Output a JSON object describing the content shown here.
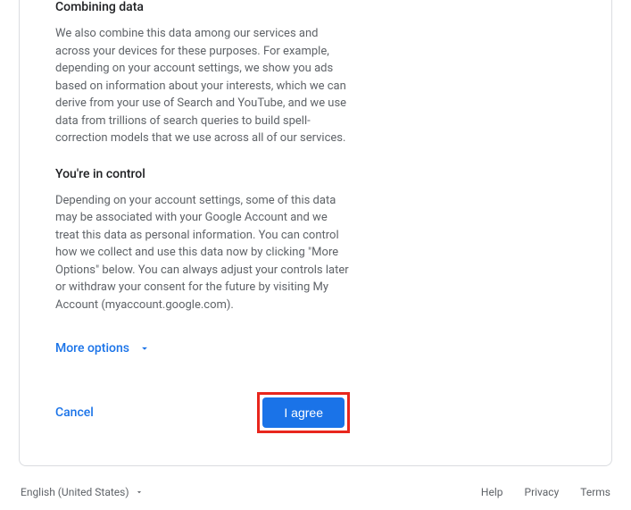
{
  "sections": {
    "combining": {
      "heading": "Combining data",
      "body": "We also combine this data among our services and across your devices for these purposes. For example, depending on your account settings, we show you ads based on information about your interests, which we can derive from your use of Search and YouTube, and we use data from trillions of search queries to build spell-correction models that we use across all of our services."
    },
    "control": {
      "heading": "You're in control",
      "body": "Depending on your account settings, some of this data may be associated with your Google Account and we treat this data as personal information. You can control how we collect and use this data now by clicking \"More Options\" below. You can always adjust your controls later or withdraw your consent for the future by visiting My Account (myaccount.google.com)."
    }
  },
  "more_options_label": "More options",
  "actions": {
    "cancel": "Cancel",
    "agree": "I agree"
  },
  "footer": {
    "language": "English (United States)",
    "links": {
      "help": "Help",
      "privacy": "Privacy",
      "terms": "Terms"
    }
  }
}
